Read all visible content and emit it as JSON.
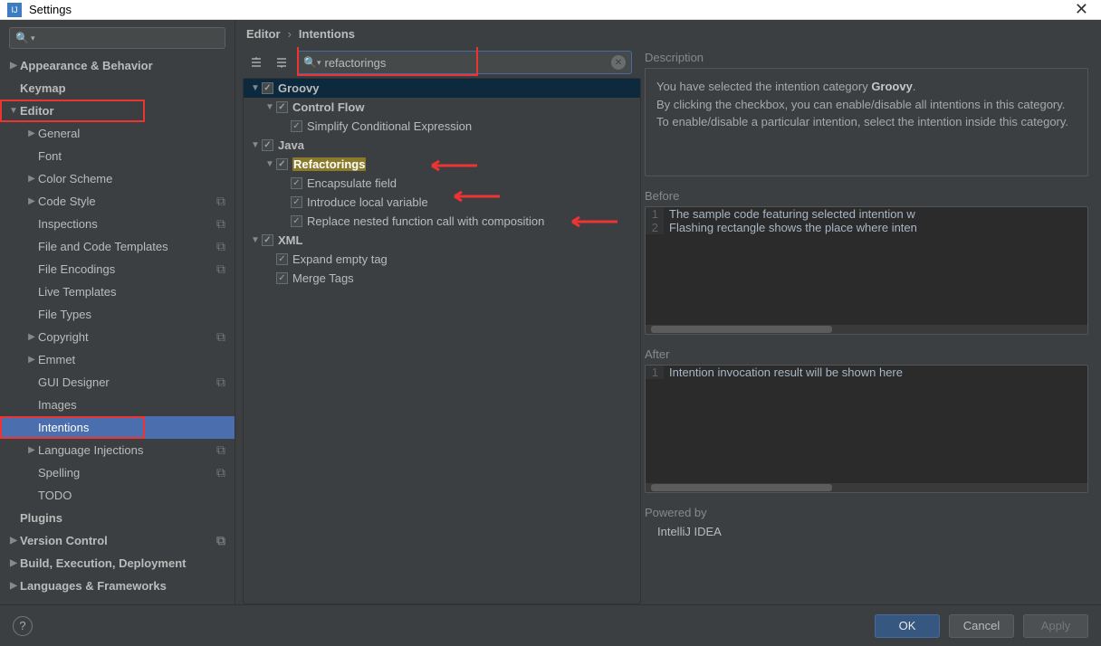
{
  "window": {
    "title": "Settings"
  },
  "breadcrumb": {
    "a": "Editor",
    "b": "Intentions"
  },
  "search": {
    "placeholder": "",
    "value": ""
  },
  "intention_search": {
    "value": "refactorings"
  },
  "sidebar": {
    "items": [
      {
        "label": "Appearance & Behavior",
        "bold": true,
        "expand": "▶",
        "indent": 0
      },
      {
        "label": "Keymap",
        "bold": true,
        "indent": 0
      },
      {
        "label": "Editor",
        "bold": true,
        "expand": "▼",
        "indent": 0,
        "redbox": true
      },
      {
        "label": "General",
        "expand": "▶",
        "indent": 1
      },
      {
        "label": "Font",
        "indent": 1
      },
      {
        "label": "Color Scheme",
        "expand": "▶",
        "indent": 1
      },
      {
        "label": "Code Style",
        "expand": "▶",
        "indent": 1,
        "copy": true
      },
      {
        "label": "Inspections",
        "indent": 1,
        "copy": true
      },
      {
        "label": "File and Code Templates",
        "indent": 1,
        "copy": true
      },
      {
        "label": "File Encodings",
        "indent": 1,
        "copy": true
      },
      {
        "label": "Live Templates",
        "indent": 1
      },
      {
        "label": "File Types",
        "indent": 1
      },
      {
        "label": "Copyright",
        "expand": "▶",
        "indent": 1,
        "copy": true
      },
      {
        "label": "Emmet",
        "expand": "▶",
        "indent": 1
      },
      {
        "label": "GUI Designer",
        "indent": 1,
        "copy": true
      },
      {
        "label": "Images",
        "indent": 1
      },
      {
        "label": "Intentions",
        "indent": 1,
        "selected": true,
        "redbox": true
      },
      {
        "label": "Language Injections",
        "expand": "▶",
        "indent": 1,
        "copy": true
      },
      {
        "label": "Spelling",
        "indent": 1,
        "copy": true
      },
      {
        "label": "TODO",
        "indent": 1
      },
      {
        "label": "Plugins",
        "bold": true,
        "indent": 0
      },
      {
        "label": "Version Control",
        "bold": true,
        "expand": "▶",
        "indent": 0,
        "copy": true
      },
      {
        "label": "Build, Execution, Deployment",
        "bold": true,
        "expand": "▶",
        "indent": 0
      },
      {
        "label": "Languages & Frameworks",
        "bold": true,
        "expand": "▶",
        "indent": 0
      }
    ]
  },
  "intentions_tree": [
    {
      "label": "Groovy",
      "pad": 0,
      "tw": "▼",
      "cb": true,
      "bold": true,
      "sel": true
    },
    {
      "label": "Control Flow",
      "pad": 1,
      "tw": "▼",
      "cb": true,
      "bold": true
    },
    {
      "label": "Simplify Conditional Expression",
      "pad": 2,
      "cb": true
    },
    {
      "label": "Java",
      "pad": 0,
      "tw": "▼",
      "cb": true,
      "bold": true
    },
    {
      "label": "Refactorings",
      "pad": 1,
      "tw": "▼",
      "cb": true,
      "bold": true,
      "hl": true
    },
    {
      "label": "Encapsulate field",
      "pad": 2,
      "cb": true
    },
    {
      "label": "Introduce local variable",
      "pad": 2,
      "cb": true
    },
    {
      "label": "Replace nested function call with composition",
      "pad": 2,
      "cb": true
    },
    {
      "label": "XML",
      "pad": 0,
      "tw": "▼",
      "cb": true,
      "bold": true
    },
    {
      "label": "Expand empty tag",
      "pad": 1,
      "cb": true
    },
    {
      "label": "Merge Tags",
      "pad": 1,
      "cb": true
    }
  ],
  "desc": {
    "title": "Description",
    "line1a": "You have selected the intention category ",
    "line1b": "Groovy",
    "line1c": ".",
    "line2": "By clicking the checkbox, you can enable/disable all intentions in this category.",
    "line3": "To enable/disable a particular intention, select the intention inside this category."
  },
  "before": {
    "title": "Before",
    "lines": [
      "The sample code featuring selected intention w",
      "Flashing rectangle shows the place where inten"
    ]
  },
  "after": {
    "title": "After",
    "lines": [
      "Intention invocation result will be shown here"
    ]
  },
  "powered": {
    "title": "Powered by",
    "value": "IntelliJ IDEA"
  },
  "buttons": {
    "ok": "OK",
    "cancel": "Cancel",
    "apply": "Apply"
  }
}
